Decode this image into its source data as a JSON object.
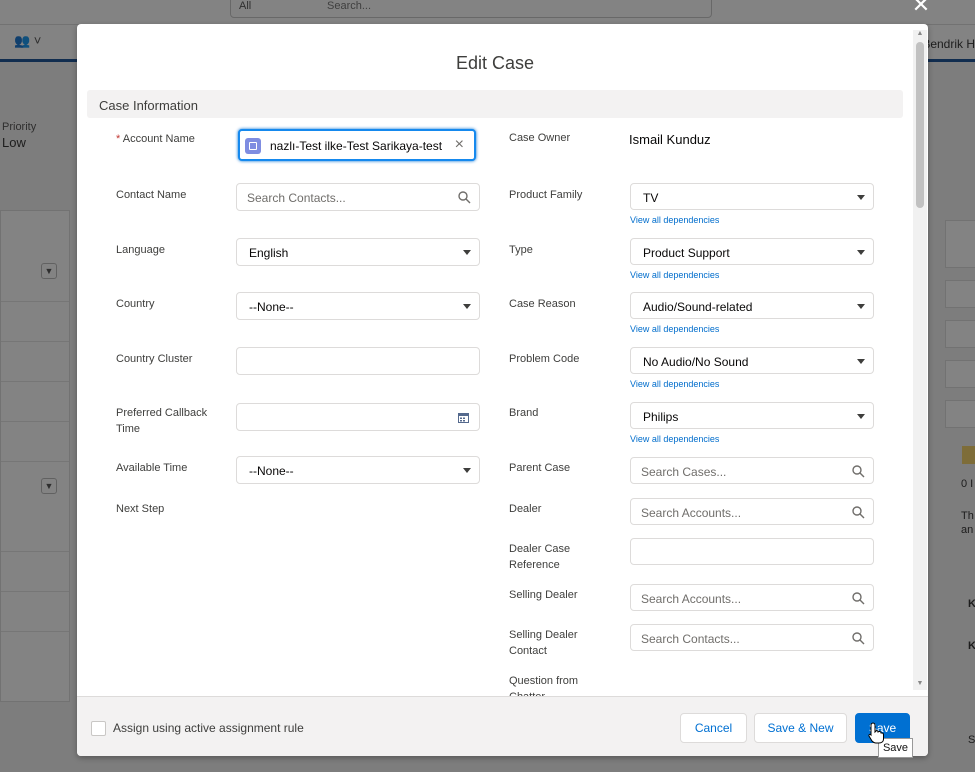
{
  "background": {
    "search_scope": "All",
    "search_placeholder": "Search...",
    "user_name": "Bendrik H",
    "highlight_priority_label": "Priority",
    "highlight_priority_value": "Low",
    "right_panel_text": [
      "0 I",
      "Th",
      "an",
      "K",
      "K",
      "S"
    ]
  },
  "modal": {
    "title": "Edit Case",
    "section_title": "Case Information",
    "left": {
      "account_name_label": "Account Name",
      "account_name_required": "*",
      "account_name_value": "nazlı-Test ilke-Test Sarikaya-test",
      "contact_name_label": "Contact Name",
      "contact_name_placeholder": "Search Contacts...",
      "language_label": "Language",
      "language_value": "English",
      "country_label": "Country",
      "country_value": "--None--",
      "country_cluster_label": "Country Cluster",
      "country_cluster_value": "",
      "preferred_callback_label": "Preferred Callback Time",
      "preferred_callback_value": "",
      "available_time_label": "Available Time",
      "available_time_value": "--None--",
      "next_step_label": "Next Step"
    },
    "right": {
      "case_owner_label": "Case Owner",
      "case_owner_value": "Ismail Kunduz",
      "product_family_label": "Product Family",
      "product_family_value": "TV",
      "type_label": "Type",
      "type_value": "Product Support",
      "case_reason_label": "Case Reason",
      "case_reason_value": "Audio/Sound-related",
      "problem_code_label": "Problem Code",
      "problem_code_value": "No Audio/No Sound",
      "brand_label": "Brand",
      "brand_value": "Philips",
      "dependencies_link": "View all dependencies",
      "parent_case_label": "Parent Case",
      "parent_case_placeholder": "Search Cases...",
      "dealer_label": "Dealer",
      "dealer_placeholder": "Search Accounts...",
      "dealer_case_reference_label": "Dealer Case Reference",
      "dealer_case_reference_value": "",
      "selling_dealer_label": "Selling Dealer",
      "selling_dealer_placeholder": "Search Accounts...",
      "selling_dealer_contact_label": "Selling Dealer Contact",
      "selling_dealer_contact_placeholder": "Search Contacts...",
      "question_from_chatter_label": "Question from Chatter"
    },
    "footer": {
      "assign_rule_label": "Assign using active assignment rule",
      "cancel_label": "Cancel",
      "save_new_label": "Save & New",
      "save_label": "Save",
      "tooltip": "Save"
    }
  },
  "colors": {
    "brand_blue": "#0070d2",
    "link_blue": "#006dcc",
    "focus_blue": "#1589ee",
    "required_red": "#c23934",
    "account_icon": "#7f8de1"
  },
  "icons": [
    "close-icon",
    "search-icon",
    "caret-down-icon",
    "calendar-icon",
    "account-object-icon",
    "clear-icon",
    "pointer-cursor-icon"
  ]
}
